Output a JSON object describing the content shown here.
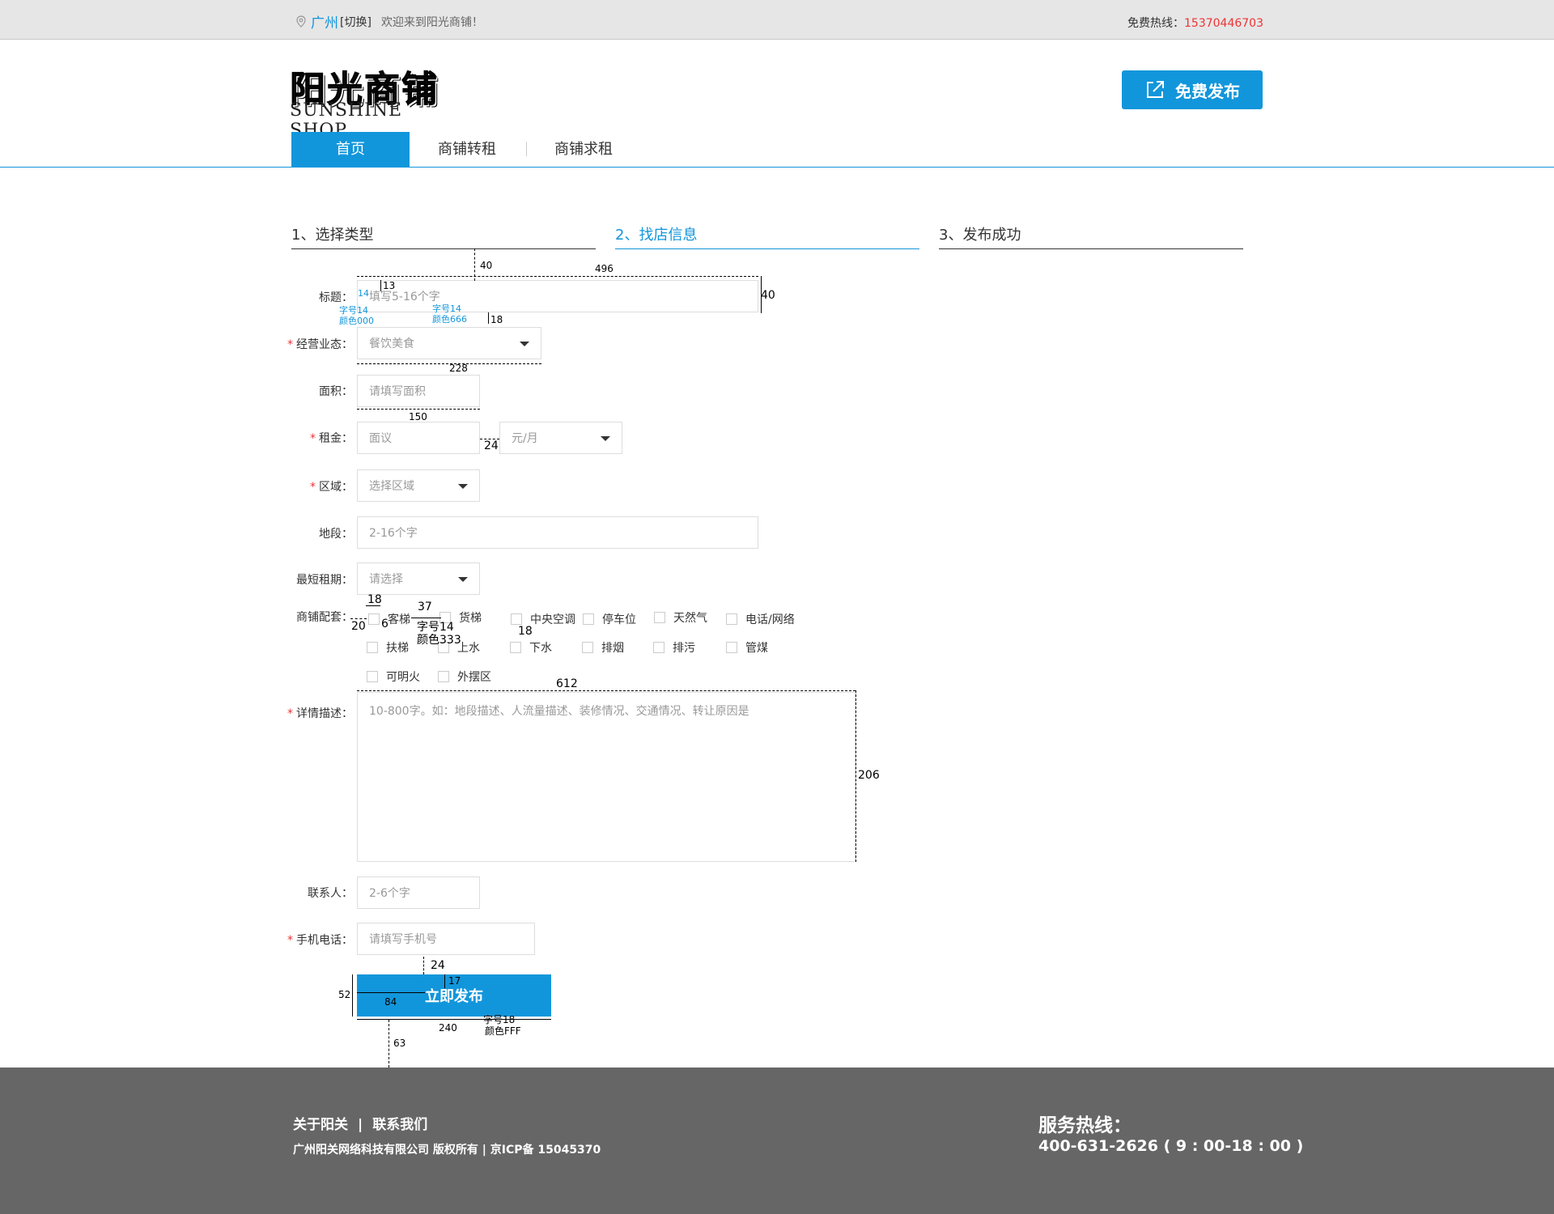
{
  "topbar": {
    "city": "广州",
    "switch_label": "[切换]",
    "welcome": "欢迎来到阳光商铺！",
    "hotline_label": "免费热线：",
    "hotline_number": "15370446703"
  },
  "logo": {
    "cn": "阳光商铺",
    "en": "SUNSHINE SHOP"
  },
  "header": {
    "publish_label": "免费发布"
  },
  "nav": {
    "items": [
      "首页",
      "商铺转租",
      "商铺求租"
    ],
    "active": "首页"
  },
  "steps": [
    "1、选择类型",
    "2、找店信息",
    "3、发布成功"
  ],
  "form": {
    "title": {
      "label": "标题：",
      "placeholder": "填写5-16个字"
    },
    "business": {
      "label": "经营业态：",
      "value": "餐饮美食"
    },
    "area": {
      "label": "面积：",
      "placeholder": "请填写面积"
    },
    "rent": {
      "label": "租金：",
      "placeholder": "面议",
      "unit": "元/月"
    },
    "region": {
      "label": "区域：",
      "value": "选择区域"
    },
    "section": {
      "label": "地段：",
      "placeholder": "2-16个字"
    },
    "min_term": {
      "label": "最短租期：",
      "value": "请选择"
    },
    "facilities": {
      "label": "商铺配套：",
      "options": [
        "客梯",
        "货梯",
        "中央空调",
        "停车位",
        "天然气",
        "电话/网络",
        "扶梯",
        "上水",
        "下水",
        "排烟",
        "排污",
        "管煤",
        "可明火",
        "外摆区"
      ]
    },
    "detail": {
      "label": "详情描述：",
      "placeholder": "10-800字。如：地段描述、人流量描述、装修情况、交通情况、转让原因是"
    },
    "contact": {
      "label": "联系人：",
      "placeholder": "2-6个字"
    },
    "phone": {
      "label": "手机电话：",
      "placeholder": "请填写手机号"
    },
    "required_mark": "*",
    "submit_label": "立即发布"
  },
  "annotations": {
    "a40top": "40",
    "a496": "496",
    "a13": "13",
    "a40right": "40",
    "a14": "14",
    "a_font14_000": "字号14",
    "a_color000": "颜色000",
    "a_font14_666": "字号14",
    "a_color666": "颜色666",
    "a18a": "18",
    "a228": "228",
    "a150": "150",
    "a24a": "24",
    "a18b": "18",
    "a37": "37",
    "a20": "20",
    "a6": "6",
    "a_font14_333": "字号14",
    "a_color333": "颜色333",
    "a18c": "18",
    "a612": "612",
    "a206": "206",
    "a24b": "24",
    "a17": "17",
    "a52": "52",
    "a84": "84",
    "a240": "240",
    "a_font18": "字号18",
    "a_colorFFF": "颜色FFF",
    "a63": "63"
  },
  "footer": {
    "about": "关于阳关",
    "sep": "|",
    "contact": "联系我们",
    "copyright": "广州阳关网络科技有限公司 版权所有 | 京ICP备 15045370",
    "service_title": "服务热线：",
    "service_number": "400-631-2626 ( 9 : 00-18 : 00 )"
  },
  "colors": {
    "accent": "#1296db",
    "required": "#ee3333",
    "footer_bg": "#666666",
    "topbar_bg": "#e6e6e6"
  }
}
